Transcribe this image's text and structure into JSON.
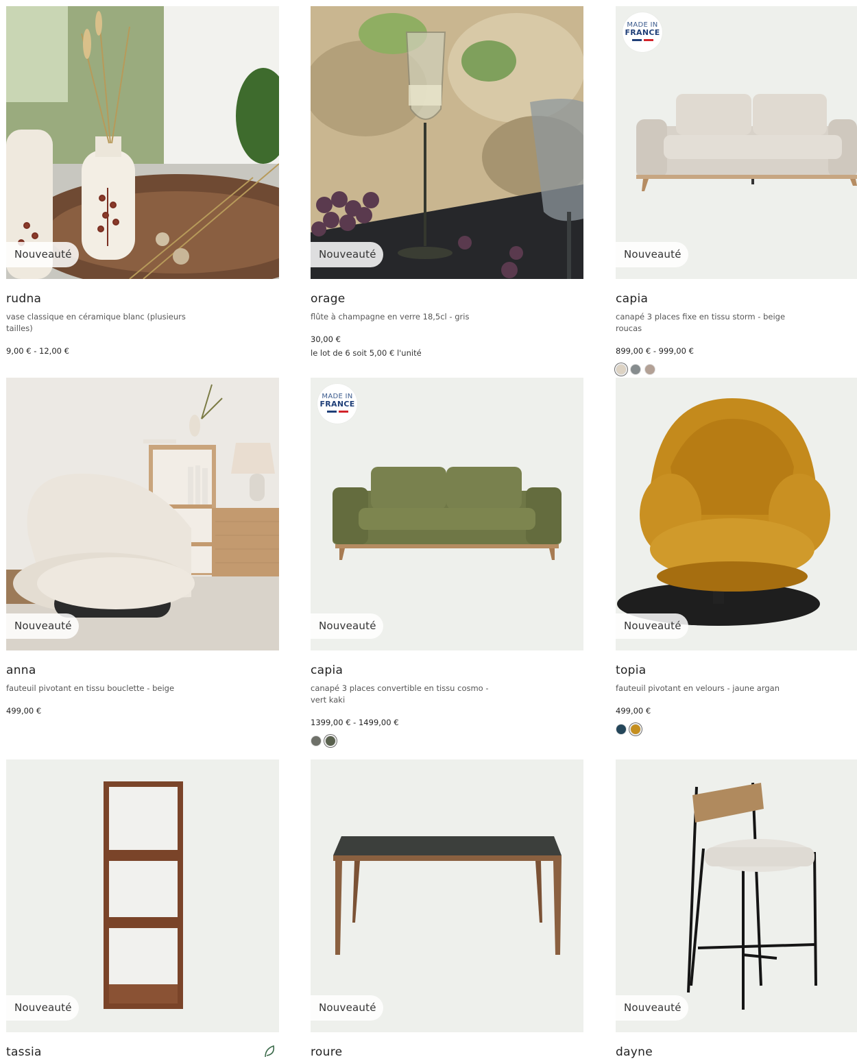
{
  "products": [
    {
      "badge": "Nouveauté",
      "name": "rudna",
      "desc": "vase classique en céramique blanc (plusieurs tailles)",
      "price": "9,00 € - 12,00 €"
    },
    {
      "badge": "Nouveauté",
      "name": "orage",
      "desc": "flûte à champagne en verre 18,5cl - gris",
      "price": "30,00 €",
      "sub": "le lot de 6 soit 5,00 € l'unité"
    },
    {
      "badge": "Nouveauté",
      "made_in_line1": "MADE IN",
      "made_in_line2": "FRANCE",
      "name": "capia",
      "desc": "canapé 3 places fixe en tissu storm - beige roucas",
      "price": "899,00 € - 999,00 €",
      "swatches": [
        "#ddd3c4",
        "#868c8e",
        "#b3a196"
      ],
      "selected_swatch": 0
    },
    {
      "badge": "Nouveauté",
      "name": "anna",
      "desc": "fauteuil pivotant en tissu bouclette - beige",
      "price": "499,00 €"
    },
    {
      "badge": "Nouveauté",
      "made_in_line1": "MADE IN",
      "made_in_line2": "FRANCE",
      "name": "capia",
      "desc": "canapé 3 places convertible en tissu cosmo - vert kaki",
      "price": "1399,00 € - 1499,00 €",
      "swatches": [
        "#6e7069",
        "#59614e"
      ],
      "selected_swatch": 1
    },
    {
      "badge": "Nouveauté",
      "name": "topia",
      "desc": "fauteuil pivotant en velours - jaune argan",
      "price": "499,00 €",
      "swatches": [
        "#24465a",
        "#c58f1f"
      ],
      "selected_swatch": 1
    },
    {
      "badge": "Nouveauté",
      "name": "tassia"
    },
    {
      "badge": "Nouveauté",
      "name": "roure"
    },
    {
      "badge": "Nouveauté",
      "name": "dayne"
    }
  ],
  "colors": {
    "flag_blue": "#1f3f78",
    "flag_red": "#d2232a",
    "image_bg": "#eef0ec"
  }
}
